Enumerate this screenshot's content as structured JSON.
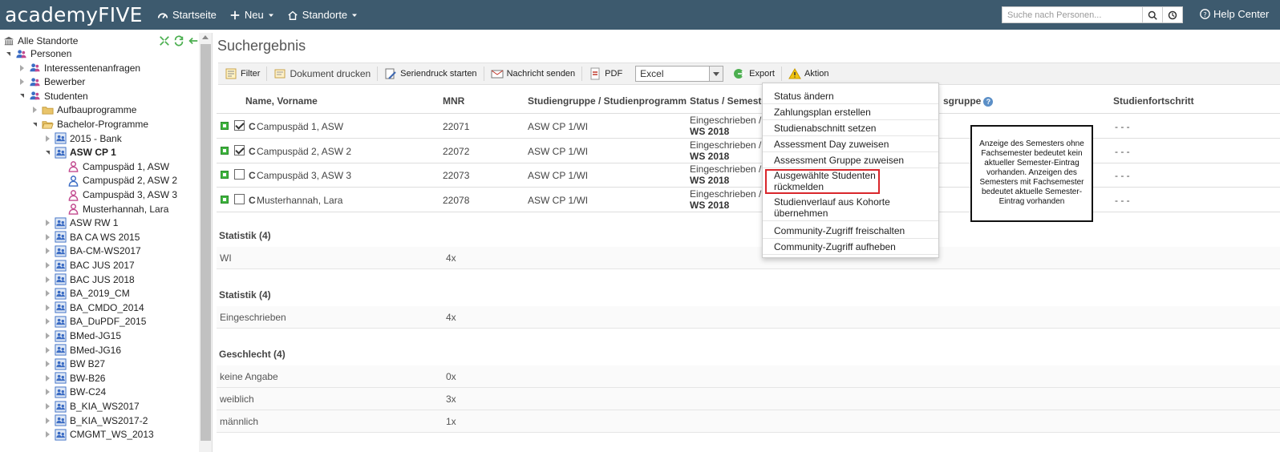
{
  "app": {
    "logo": "academyFIVE",
    "nav": [
      {
        "label": "Startseite",
        "icon": "dashboard-icon"
      },
      {
        "label": "Neu",
        "icon": "plus-icon"
      },
      {
        "label": "Standorte",
        "icon": "home-icon"
      }
    ],
    "search_placeholder": "Suche nach Personen...",
    "help": "Help Center"
  },
  "sidebar": {
    "root": "Alle Standorte",
    "items": [
      {
        "label": "Personen",
        "level": 1,
        "toggle": "open",
        "icon": "people-icon"
      },
      {
        "label": "Interessentenanfragen",
        "level": 2,
        "toggle": "closed",
        "icon": "people-icon"
      },
      {
        "label": "Bewerber",
        "level": 2,
        "toggle": "closed",
        "icon": "people-icon"
      },
      {
        "label": "Studenten",
        "level": 2,
        "toggle": "open",
        "icon": "people-icon"
      },
      {
        "label": "Aufbauprogramme",
        "level": 3,
        "toggle": "closed",
        "icon": "folder-icon"
      },
      {
        "label": "Bachelor-Programme",
        "level": 3,
        "toggle": "open",
        "icon": "folder-open-icon"
      },
      {
        "label": "2015 - Bank",
        "level": 4,
        "toggle": "closed",
        "icon": "group-icon"
      },
      {
        "label": "ASW CP 1",
        "level": 4,
        "toggle": "open",
        "icon": "group-icon",
        "bold": true
      },
      {
        "label": "Campuspäd 1, ASW",
        "level": 5,
        "toggle": "none",
        "icon": "female-user-icon"
      },
      {
        "label": "Campuspäd 2, ASW 2",
        "level": 5,
        "toggle": "none",
        "icon": "male-user-icon"
      },
      {
        "label": "Campuspäd 3, ASW 3",
        "level": 5,
        "toggle": "none",
        "icon": "female-user-icon"
      },
      {
        "label": "Musterhannah, Lara",
        "level": 5,
        "toggle": "none",
        "icon": "female-user-icon"
      },
      {
        "label": "ASW RW 1",
        "level": 4,
        "toggle": "closed",
        "icon": "group-icon"
      },
      {
        "label": "BA CA WS 2015",
        "level": 4,
        "toggle": "closed",
        "icon": "group-icon"
      },
      {
        "label": "BA-CM-WS2017",
        "level": 4,
        "toggle": "closed",
        "icon": "group-icon"
      },
      {
        "label": "BAC JUS 2017",
        "level": 4,
        "toggle": "closed",
        "icon": "group-icon"
      },
      {
        "label": "BAC JUS 2018",
        "level": 4,
        "toggle": "closed",
        "icon": "group-icon"
      },
      {
        "label": "BA_2019_CM",
        "level": 4,
        "toggle": "closed",
        "icon": "group-icon"
      },
      {
        "label": "BA_CMDO_2014",
        "level": 4,
        "toggle": "closed",
        "icon": "group-icon"
      },
      {
        "label": "BA_DuPDF_2015",
        "level": 4,
        "toggle": "closed",
        "icon": "group-icon"
      },
      {
        "label": "BMed-JG15",
        "level": 4,
        "toggle": "closed",
        "icon": "group-icon"
      },
      {
        "label": "BMed-JG16",
        "level": 4,
        "toggle": "closed",
        "icon": "group-icon"
      },
      {
        "label": "BW B27",
        "level": 4,
        "toggle": "closed",
        "icon": "group-icon"
      },
      {
        "label": "BW-B26",
        "level": 4,
        "toggle": "closed",
        "icon": "group-icon"
      },
      {
        "label": "BW-C24",
        "level": 4,
        "toggle": "closed",
        "icon": "group-icon"
      },
      {
        "label": "B_KIA_WS2017",
        "level": 4,
        "toggle": "closed",
        "icon": "group-icon"
      },
      {
        "label": "B_KIA_WS2017-2",
        "level": 4,
        "toggle": "closed",
        "icon": "group-icon"
      },
      {
        "label": "CMGMT_WS_2013",
        "level": 4,
        "toggle": "closed",
        "icon": "group-icon"
      }
    ]
  },
  "main": {
    "title": "Suchergebnis",
    "toolbar": {
      "filter": "Filter",
      "print": "Dokument drucken",
      "serial": "Seriendruck starten",
      "message": "Nachricht senden",
      "pdf": "PDF",
      "format": "Excel",
      "export": "Export",
      "action": "Aktion"
    },
    "columns": {
      "name": "Name, Vorname",
      "mnr": "MNR",
      "group": "Studiengruppe / Studienprogramm",
      "status": "Status / Semeste",
      "sgruppe": "sgruppe",
      "progress": "Studienfortschritt"
    },
    "rows": [
      {
        "prefix": "C",
        "name": "Campuspäd 1, ASW",
        "mnr": "22071",
        "group": "ASW CP 1/WI",
        "status": "Eingeschrieben /",
        "semester": "WS 2018",
        "progress": "- - -",
        "checked": true
      },
      {
        "prefix": "C",
        "name": "Campuspäd 2, ASW 2",
        "mnr": "22072",
        "group": "ASW CP 1/WI",
        "status": "Eingeschrieben /",
        "semester": "WS 2018",
        "progress": "- - -",
        "checked": true
      },
      {
        "prefix": "C",
        "name": "Campuspäd 3, ASW 3",
        "mnr": "22073",
        "group": "ASW CP 1/WI",
        "status": "Eingeschrieben /",
        "semester": "WS 2018",
        "progress": "- - -",
        "checked": false
      },
      {
        "prefix": "C",
        "name": "Musterhannah, Lara",
        "mnr": "22078",
        "group": "ASW CP 1/WI",
        "status": "Eingeschrieben /",
        "semester": "WS 2018",
        "progress": "- - -",
        "checked": false
      }
    ],
    "stats": [
      {
        "title": "Statistik (4)",
        "rows": [
          {
            "k": "WI",
            "v": "4x"
          }
        ]
      },
      {
        "title": "Statistik (4)",
        "rows": [
          {
            "k": "Eingeschrieben",
            "v": "4x"
          }
        ]
      },
      {
        "title": "Geschlecht (4)",
        "rows": [
          {
            "k": "keine Angabe",
            "v": "0x"
          },
          {
            "k": "weiblich",
            "v": "3x"
          },
          {
            "k": "männlich",
            "v": "1x"
          }
        ]
      }
    ]
  },
  "action_menu": [
    "Status ändern",
    "Zahlungsplan erstellen",
    "Studienabschnitt setzen",
    "Assessment Day zuweisen",
    "Assessment Gruppe zuweisen",
    "Ausgewählte Studenten rückmelden",
    "Studienverlauf aus Kohorte übernehmen",
    "Community-Zugriff freischalten",
    "Community-Zugriff aufheben"
  ],
  "tooltip": "Anzeige des Semesters ohne Fachsemester bedeutet kein aktueller Semester-Eintrag vorhanden. Anzeigen des Semesters mit Fachsemester bedeutet aktuelle Semester-Eintrag vorhanden",
  "colors": {
    "topbar": "#3d5a6e",
    "accent": "#3fb53f",
    "highlight": "#d9262b"
  }
}
